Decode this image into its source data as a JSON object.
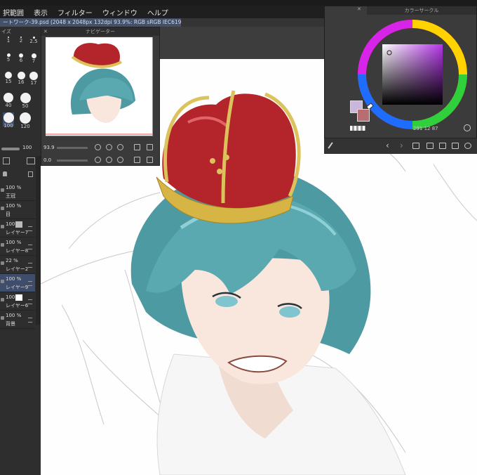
{
  "menu": [
    "択範囲",
    "表示",
    "フィルター",
    "ウィンドウ",
    "ヘルプ"
  ],
  "document_tab": "ートワーク-39.psd (2048 x 2048px 132dpi 93.9%: RGB sRGB IEC61966-2.1)",
  "brush_panel": {
    "title": "イズ",
    "sizes": [
      "1",
      "2",
      "2.5",
      "5",
      "6",
      "7",
      "15",
      "16",
      "17",
      "40",
      "50",
      "100",
      "120"
    ],
    "current": "100"
  },
  "navigator": {
    "title": "ナビゲーター",
    "zoom": "93.9",
    "rotation": "0.0"
  },
  "color_panel": {
    "title": "カラーサークル",
    "readout": "291 12 87",
    "colors": {
      "main": "#c9b6da",
      "sub": "#b86e70",
      "hue_square": "#b436e8"
    }
  },
  "layers": [
    {
      "pct": "100 %",
      "name": "王冠"
    },
    {
      "pct": "100 %",
      "name": "目"
    },
    {
      "pct": "100",
      "name": "レイヤー7"
    },
    {
      "pct": "100 %",
      "name": "レイヤー8"
    },
    {
      "pct": "22 %",
      "name": "レイヤー2"
    },
    {
      "pct": "100 %",
      "name": "レイヤー9"
    },
    {
      "pct": "100",
      "name": "レイヤー6"
    },
    {
      "pct": "100 %",
      "name": "背景"
    }
  ],
  "icons": [
    "eyedropper-icon",
    "back-icon",
    "forward-icon",
    "folder-icon",
    "new-file-icon",
    "camera-icon",
    "edit-icon",
    "settings-icon",
    "lock-icon",
    "trash-icon"
  ]
}
